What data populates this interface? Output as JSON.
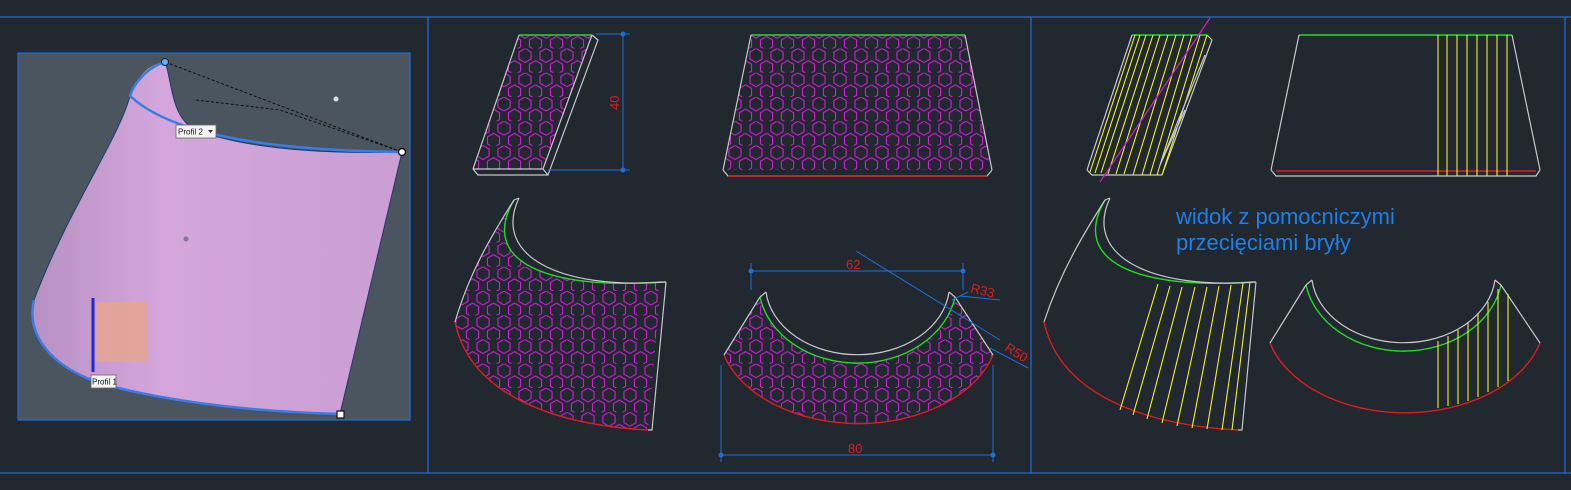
{
  "viewport_left": {
    "profile_label_1": "Profil 1",
    "profile_label_2": "Profil 2"
  },
  "dimensions": {
    "height": "40",
    "top_width": "62",
    "bottom_width": "80",
    "radius_small": "R33",
    "radius_large": "R50"
  },
  "note": {
    "line1": "widok z pomocniczymi",
    "line2": "przecięciami bryły"
  },
  "colors": {
    "background": "#212830",
    "frame": "#1e6fd9",
    "hatch": "#d21ed2",
    "edge_top": "#23dc23",
    "edge_bottom": "#dc1e1e",
    "edge_side": "#c8c8c8",
    "section_lines": "#f0f028",
    "dimension_text": "#dc1e1e",
    "dimension_line": "#1e6fd9",
    "note_text": "#1e7fe6",
    "surface": "#c89cd2"
  }
}
